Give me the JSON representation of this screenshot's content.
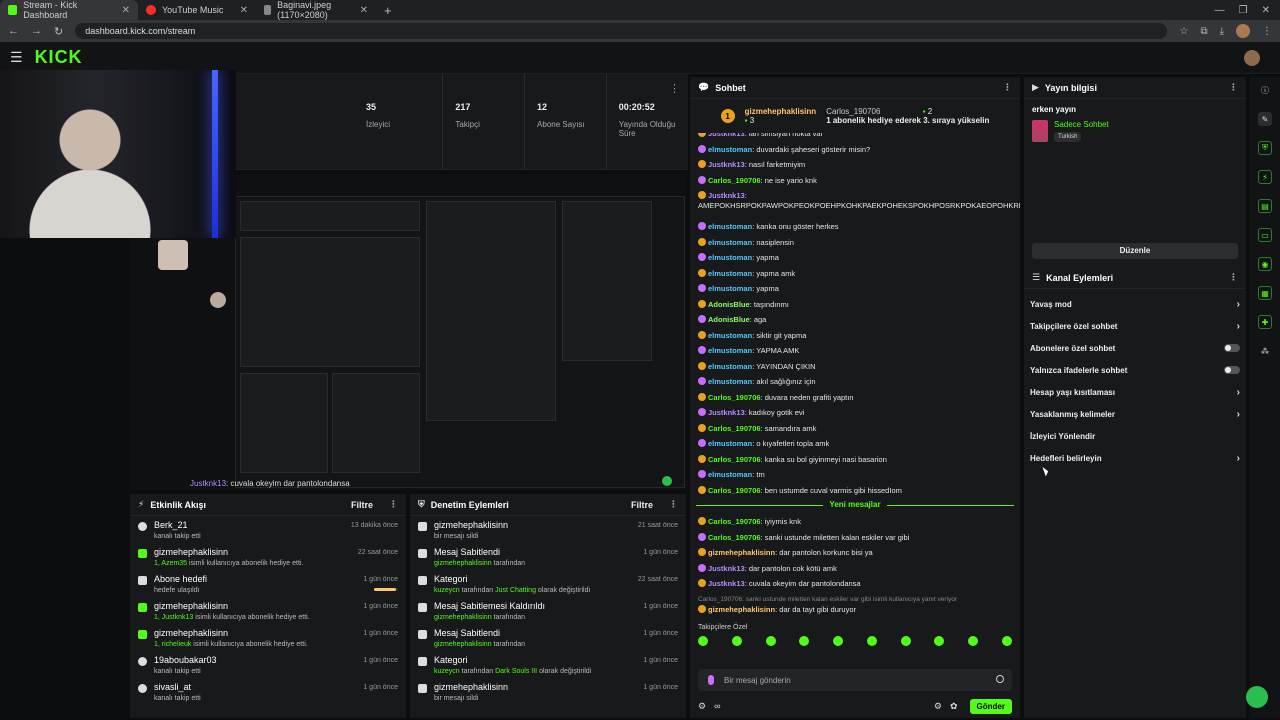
{
  "browser": {
    "tabs": [
      {
        "title": "Stream - Kick Dashboard",
        "color": "#53fc18"
      },
      {
        "title": "YouTube Music",
        "color": "#ff2b2b"
      },
      {
        "title": "Baginavi.jpeg (1170×2080)",
        "color": "#888888"
      }
    ],
    "url": "dashboard.kick.com/stream"
  },
  "header": {
    "logo": "KICK"
  },
  "stats": [
    {
      "value": "35",
      "label": "İzleyici"
    },
    {
      "value": "217",
      "label": "Takipçi"
    },
    {
      "value": "12",
      "label": "Abone Sayısı"
    },
    {
      "value": "00:20:52",
      "label": "Yayında Olduğu Süre"
    }
  ],
  "preview_caption": {
    "user": "Justknk13",
    "text": ": cuvala okeyim dar pantolondansa"
  },
  "activity": {
    "title": "Etkinlik Akışı",
    "filter": "Filtre",
    "items": [
      {
        "name": "Berk_21",
        "sub": "kanalı takip etti",
        "highlight": "",
        "time": "13 dakika önce",
        "icon": "heart"
      },
      {
        "name": "gizmehephaklisinn",
        "sub": " isimli kullanıcıya abonelik hediye etti.",
        "highlight": "1, Azem35",
        "time": "22 saat önce",
        "icon": "gift"
      },
      {
        "name": "Abone hedefi",
        "sub": "hedefe ulaşıldı",
        "highlight": "",
        "time": "1 gün önce",
        "icon": "goal",
        "progress": 0.9
      },
      {
        "name": "gizmehephaklisinn",
        "sub": " isimli kullanıcıya abonelik hediye etti.",
        "highlight": "1, Justknk13",
        "time": "1 gün önce",
        "icon": "gift"
      },
      {
        "name": "gizmehephaklisinn",
        "sub": " isimli kullanıcıya abonelik hediye etti.",
        "highlight": "1, richelieuk",
        "time": "1 gün önce",
        "icon": "gift"
      },
      {
        "name": "19aboubakar03",
        "sub": "kanalı takip etti",
        "highlight": "",
        "time": "1 gün önce",
        "icon": "heart"
      },
      {
        "name": "sivasli_at",
        "sub": "kanalı takip etti",
        "highlight": "",
        "time": "1 gün önce",
        "icon": "heart"
      }
    ]
  },
  "moderation": {
    "title": "Denetim Eylemleri",
    "filter": "Filtre",
    "items": [
      {
        "name": "gizmehephaklisinn",
        "sub": "bir mesajı sildi",
        "highlight": "",
        "highlight2": "",
        "tail": "",
        "time": "21 saat önce"
      },
      {
        "name": "Mesaj Sabitlendi",
        "sub": " tarafından",
        "highlight": "gizmehephaklisinn",
        "highlight2": "",
        "tail": "",
        "time": "1 gün önce"
      },
      {
        "name": "Kategori",
        "sub": " tarafından ",
        "highlight": "kuzeycn",
        "highlight2": "Just Chatting",
        "tail": " olarak değiştirildi",
        "time": "22 saat önce"
      },
      {
        "name": "Mesaj Sabitlemesi Kaldırıldı",
        "sub": " tarafından",
        "highlight": "gizmehephaklisinn",
        "highlight2": "",
        "tail": "",
        "time": "1 gün önce"
      },
      {
        "name": "Mesaj Sabitlendi",
        "sub": " tarafından",
        "highlight": "gizmehephaklisinn",
        "highlight2": "",
        "tail": "",
        "time": "1 gün önce"
      },
      {
        "name": "Kategori",
        "sub": " tarafından ",
        "highlight": "kuzeycn",
        "highlight2": "Dark Souls III",
        "tail": " olarak değiştirildi",
        "time": "1 gün önce"
      },
      {
        "name": "gizmehephaklisinn",
        "sub": "bir mesajı sildi",
        "highlight": "",
        "highlight2": "",
        "tail": "",
        "time": "1 gün önce"
      }
    ]
  },
  "chat": {
    "title": "Sohbet",
    "pinned": {
      "rank": "1",
      "gifter": "gizmehephaklisinn",
      "gifter_count": "3",
      "recipient": "Carlos_190706",
      "recipient_count": "2",
      "message": "1 abonelik hediye ederek 3. sıraya yükselin"
    },
    "messages": [
      {
        "user": "Justknk13",
        "text": ": lan simsiyah nokta var",
        "color": "#b58cff"
      },
      {
        "user": "elmustoman",
        "text": ": duvardaki şaheseri gösterir misin?",
        "color": "#53c8fc"
      },
      {
        "user": "Justknk13",
        "text": ": nasıl farketmiyim",
        "color": "#b58cff"
      },
      {
        "user": "Carlos_190706",
        "text": ": ne ise yario knk",
        "color": "#53fc18"
      },
      {
        "user": "Justknk13",
        "text": ": AMEPOKHSRPOKPAWPOKPEOKPOEHPKOHKPAEKPOHEKSPOKHPOSRKPOKAEOPOHKRPOKHSEPOKAEOPOHKPORSKPOHSRKPOKPEOHKSRPOKHPSKRSOOKEPOHKEA",
        "color": "#b58cff"
      },
      {
        "user": "elmustoman",
        "text": ": kanka onu göster herkes",
        "color": "#53c8fc"
      },
      {
        "user": "elmustoman",
        "text": ": nasiplensin",
        "color": "#53c8fc"
      },
      {
        "user": "elmustoman",
        "text": ": yapma",
        "color": "#53c8fc"
      },
      {
        "user": "elmustoman",
        "text": ": yapma amk",
        "color": "#53c8fc"
      },
      {
        "user": "elmustoman",
        "text": ": yapma",
        "color": "#53c8fc"
      },
      {
        "user": "AdonisBlue",
        "text": ": taşındınmı",
        "color": "#8cff6b"
      },
      {
        "user": "AdonisBlue",
        "text": ": aga",
        "color": "#8cff6b"
      },
      {
        "user": "elmustoman",
        "text": ": siktir git yapma",
        "color": "#53c8fc"
      },
      {
        "user": "elmustoman",
        "text": ": YAPMA AMK",
        "color": "#53c8fc"
      },
      {
        "user": "elmustoman",
        "text": ": YAYINDAN ÇIKIN",
        "color": "#53c8fc"
      },
      {
        "user": "elmustoman",
        "text": ": akıl sağlığınız için",
        "color": "#53c8fc"
      },
      {
        "user": "Carlos_190706",
        "text": ": duvara neden grafiti yaptın",
        "color": "#53fc18"
      },
      {
        "user": "Justknk13",
        "text": ": kadıkoy gotik evi",
        "color": "#b58cff"
      },
      {
        "user": "Carlos_190706",
        "text": ": samandıra amk",
        "color": "#53fc18"
      },
      {
        "user": "elmustoman",
        "text": ": o kıyafetleri topla amk",
        "color": "#53c8fc"
      },
      {
        "user": "Carlos_190706",
        "text": ": kanka su bol giyinmeyi nasi basarion",
        "color": "#53fc18"
      },
      {
        "user": "elmustoman",
        "text": ": tm",
        "color": "#53c8fc"
      },
      {
        "user": "Carlos_190706",
        "text": ": ben ustumde cuval varmis gibi hissedIom",
        "color": "#53fc18"
      }
    ],
    "new_messages_label": "Yeni mesajlar",
    "new_messages": [
      {
        "user": "Carlos_190706",
        "text": ": iyiymis knk",
        "color": "#53fc18"
      },
      {
        "user": "Carlos_190706",
        "text": ": sanki ustunde miletten kalan eskiler var gibi",
        "color": "#53fc18"
      },
      {
        "user": "gizmehephaklisinn",
        "text": ": dar pantolon korkunc bisi ya",
        "color": "#ffc66b"
      },
      {
        "user": "Justknk13",
        "text": ": dar pantolon cok kötü amk",
        "color": "#b58cff"
      },
      {
        "user": "Justknk13",
        "text": ": cuvala okeyim dar pantolondansa",
        "color": "#b58cff"
      },
      {
        "user": "",
        "text": "Carlos_190706: sanki ustunde miletten kalan eskiler var gibi isimli kullanıcıya yanıt veriyor",
        "color": "#888888"
      },
      {
        "user": "gizmehephaklisinn",
        "text": ": dar da tayt gibi duruyor",
        "color": "#ffc66b"
      }
    ],
    "followers_label": "Takipçilere Özel",
    "input_placeholder": "Bir mesaj gönderin",
    "send_label": "Gönder"
  },
  "stream_info": {
    "title": "Yayın bilgisi",
    "stream_title": "erken yayın",
    "category": "Sadece Sohbet",
    "language": "Turkish",
    "edit_label": "Düzenle"
  },
  "channel_actions": {
    "title": "Kanal Eylemleri",
    "items": [
      {
        "label": "Yavaş mod",
        "kind": "chevron"
      },
      {
        "label": "Takipçilere özel sohbet",
        "kind": "chevron"
      },
      {
        "label": "Abonelere özel sohbet",
        "kind": "toggle"
      },
      {
        "label": "Yalnızca ifadelerle sohbet",
        "kind": "toggle"
      },
      {
        "label": "Hesap yaşı kısıtlaması",
        "kind": "chevron"
      },
      {
        "label": "Yasaklanmış kelimeler",
        "kind": "chevron"
      },
      {
        "label": "İzleyici Yönlendir",
        "kind": "none"
      },
      {
        "label": "Hedefleri belirleyin",
        "kind": "chevron"
      }
    ]
  }
}
